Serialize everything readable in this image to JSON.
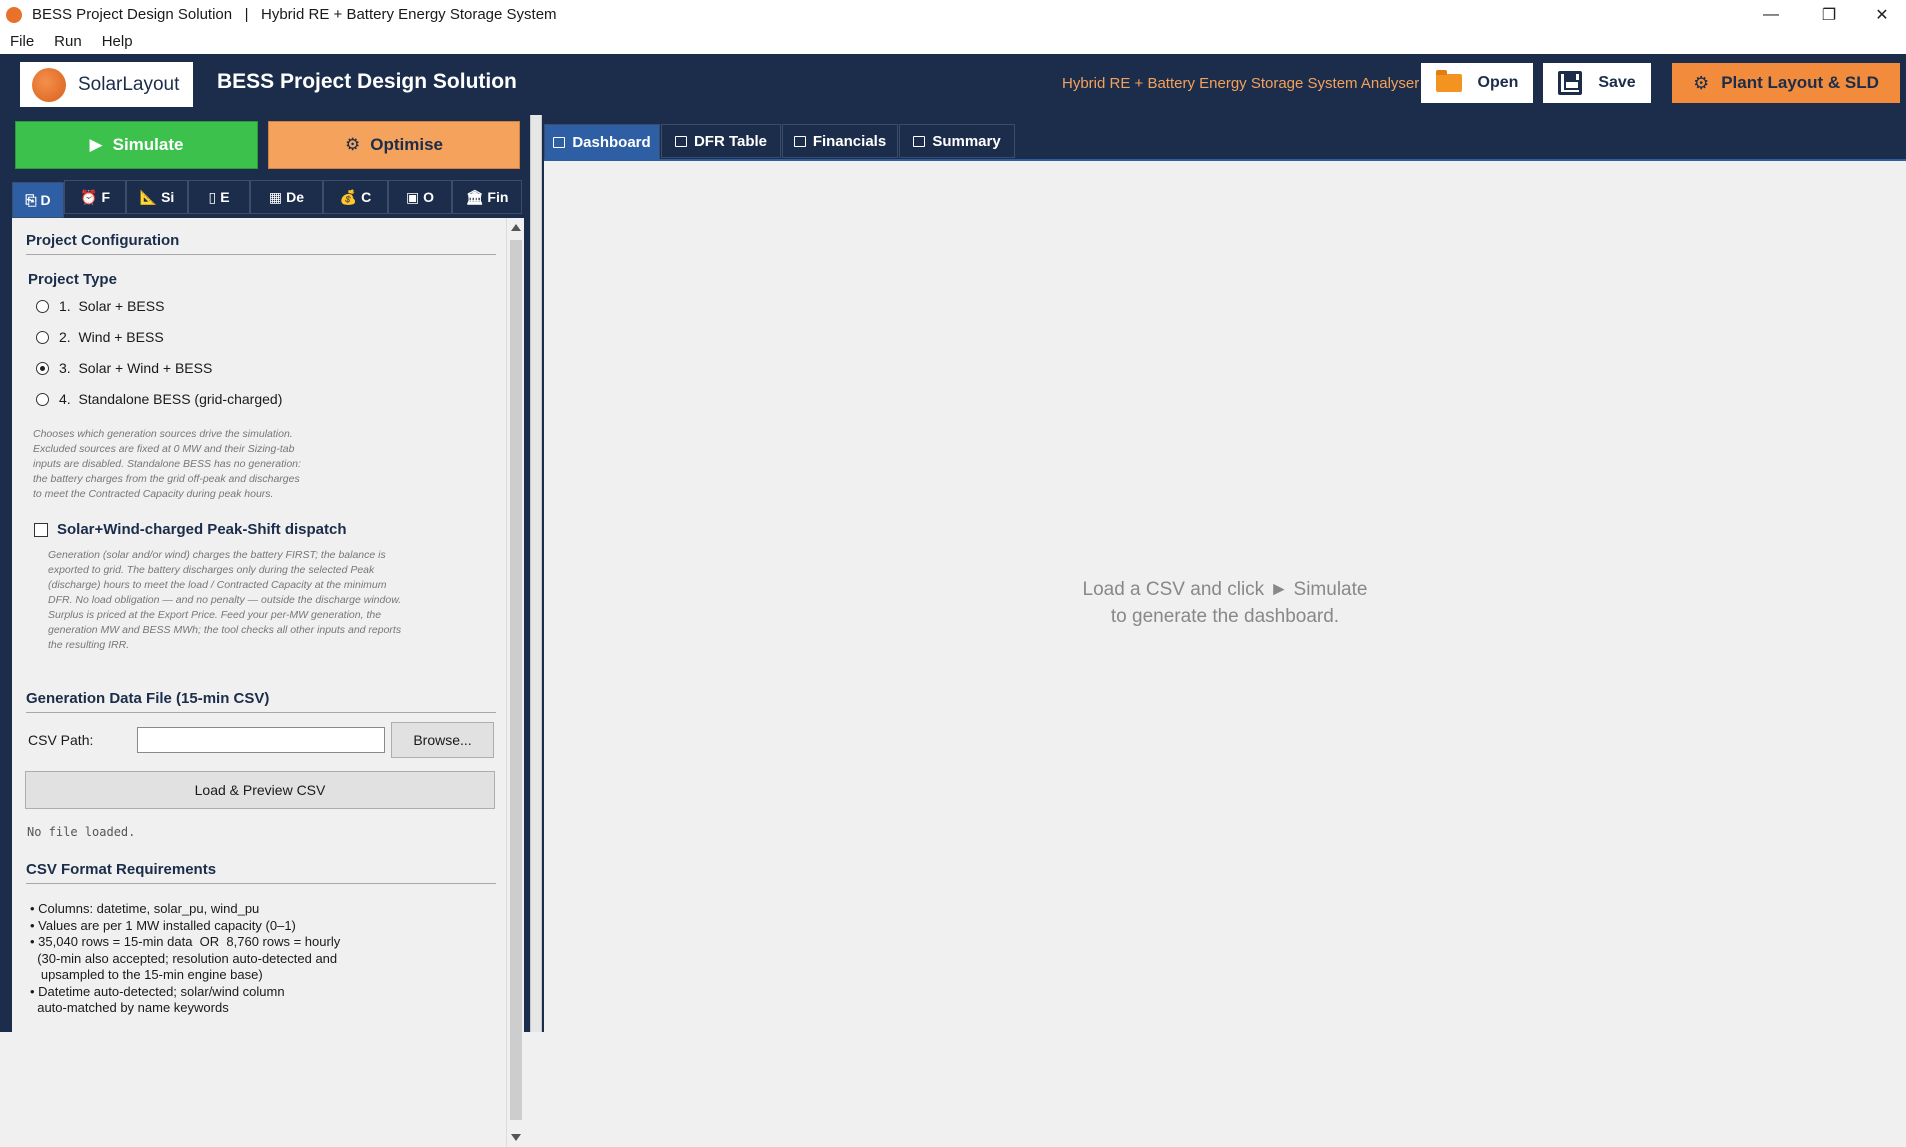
{
  "window": {
    "title": "BESS Project Design Solution   |   Hybrid RE + Battery Energy Storage System",
    "controls": {
      "minimize": "—",
      "maximize": "❐",
      "close": "✕"
    }
  },
  "menu": {
    "file": "File",
    "run": "Run",
    "help": "Help"
  },
  "header": {
    "logo_text": "SolarLayout",
    "title": "BESS Project Design Solution",
    "subtitle": "Hybrid RE + Battery Energy Storage System Analyser",
    "open_label": "Open",
    "save_label": "Save",
    "plant_layout_label": "Plant Layout & SLD",
    "accent_color": "#f28c3c",
    "header_color": "#1b2d4a"
  },
  "actions": {
    "simulate_label": "Simulate",
    "optimise_label": "Optimise",
    "simulate_color": "#3cc14d",
    "optimise_color": "#f4a25c"
  },
  "left_tabs": [
    {
      "label": "D",
      "icon": "folder-icon",
      "active": true
    },
    {
      "label": "F",
      "icon": "alarm-clock-icon"
    },
    {
      "label": "Si",
      "icon": "ruler-icon"
    },
    {
      "label": "E",
      "icon": "battery-icon"
    },
    {
      "label": "De",
      "icon": "calendar-icon"
    },
    {
      "label": "C",
      "icon": "money-bag-icon"
    },
    {
      "label": "O",
      "icon": "inbox-icon"
    },
    {
      "label": "Fin",
      "icon": "bank-icon"
    }
  ],
  "project_config": {
    "section_title": "Project Configuration",
    "project_type_title": "Project Type",
    "options": [
      {
        "label": "1.  Solar + BESS",
        "checked": false
      },
      {
        "label": "2.  Wind + BESS",
        "checked": false
      },
      {
        "label": "3.  Solar + Wind + BESS",
        "checked": true
      },
      {
        "label": "4.  Standalone BESS (grid-charged)",
        "checked": false
      }
    ],
    "note_lines": [
      "Chooses which generation sources drive the simulation.",
      "Excluded sources are fixed at 0 MW and their Sizing-tab",
      "inputs are disabled.  Standalone BESS has no generation:",
      "the battery charges from the grid off-peak and discharges",
      "to meet the Contracted Capacity during peak hours."
    ],
    "peak_shift_label": "Solar+Wind-charged Peak-Shift dispatch",
    "peak_shift_checked": false,
    "peak_shift_note_lines": [
      "Generation (solar and/or wind) charges the battery FIRST; the balance is",
      "exported to grid. The battery discharges only during the selected Peak",
      "(discharge) hours to meet the load / Contracted Capacity at the minimum",
      "DFR. No load obligation — and no penalty — outside the discharge window.",
      "Surplus is priced at the Export Price. Feed your per-MW generation, the",
      "generation MW and BESS MWh; the tool checks all other inputs and reports",
      "the resulting IRR."
    ]
  },
  "generation": {
    "section_title": "Generation Data File (15-min CSV)",
    "csv_label": "CSV Path:",
    "csv_value": "",
    "browse_label": "Browse...",
    "load_label": "Load & Preview CSV",
    "status": "No file loaded."
  },
  "requirements": {
    "section_title": "CSV Format Requirements",
    "lines": [
      "• Columns: datetime, solar_pu, wind_pu",
      "• Values are per 1 MW installed capacity (0–1)",
      "• 35,040 rows = 15-min data  OR  8,760 rows = hourly",
      "  (30-min also accepted; resolution auto-detected and",
      "   upsampled to the 15-min engine base)",
      "• Datetime auto-detected; solar/wind column",
      "  auto-matched by name keywords"
    ]
  },
  "right_tabs": [
    {
      "label": "Dashboard",
      "icon": "chart-icon",
      "active": true
    },
    {
      "label": "DFR Table",
      "icon": "clipboard-icon"
    },
    {
      "label": "Financials",
      "icon": "card-icon"
    },
    {
      "label": "Summary",
      "icon": "document-icon"
    }
  ],
  "dashboard": {
    "placeholder_line1": "Load a CSV and click ► Simulate",
    "placeholder_line2": "to generate the dashboard."
  }
}
